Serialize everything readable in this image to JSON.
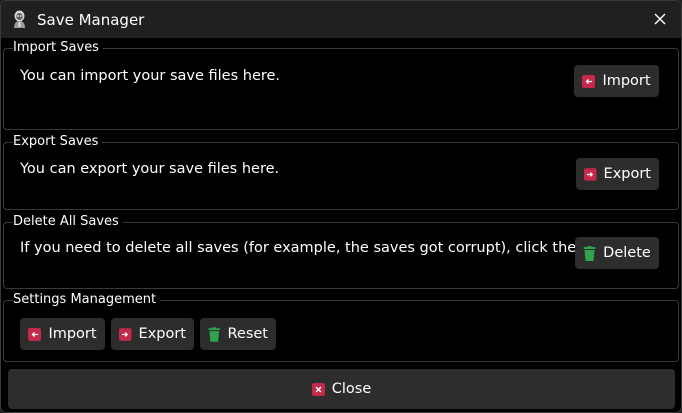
{
  "window": {
    "title": "Save Manager",
    "app_icon": "game-character-icon",
    "close_icon": "close-icon"
  },
  "import_saves": {
    "title": "Import Saves",
    "description": "You can import your save files here.",
    "button_label": "Import",
    "button_icon": "import-icon"
  },
  "export_saves": {
    "title": "Export Saves",
    "description": "You can export your save files here.",
    "button_label": "Export",
    "button_icon": "export-icon"
  },
  "delete_saves": {
    "title": "Delete All Saves",
    "description": "If you need to delete all saves (for example, the saves got corrupt), click the button.",
    "button_label": "Delete",
    "button_icon": "trash-icon"
  },
  "settings_management": {
    "title": "Settings Management",
    "buttons": [
      {
        "label": "Import",
        "icon": "import-icon"
      },
      {
        "label": "Export",
        "icon": "export-icon"
      },
      {
        "label": "Reset",
        "icon": "trash-icon"
      }
    ]
  },
  "footer": {
    "close_label": "Close",
    "close_icon": "close-box-icon"
  },
  "colors": {
    "background": "#000000",
    "titlebar": "#202020",
    "button": "#2d2d2d",
    "border": "#3a3a3a",
    "accent_red": "#c4284a",
    "accent_green": "#2ea44f"
  }
}
